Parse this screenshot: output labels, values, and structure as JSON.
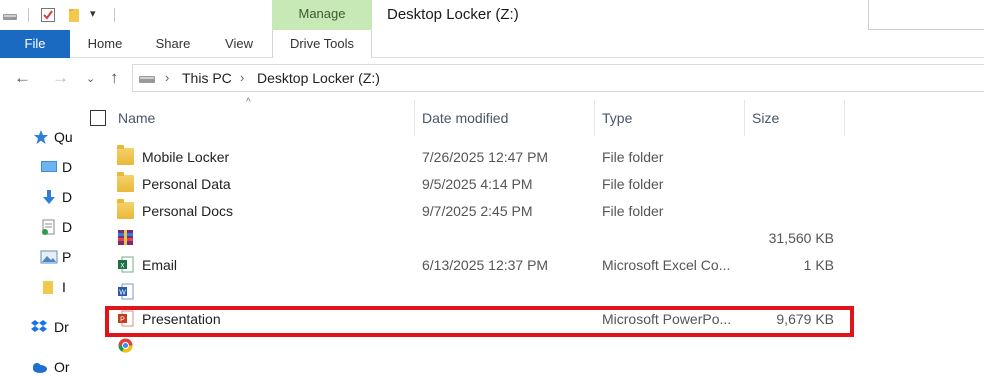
{
  "titlebar": {
    "manage_tab": "Manage",
    "window_title": "Desktop Locker (Z:)",
    "qa_dropdown": "▾"
  },
  "ribbon": {
    "file": "File",
    "home": "Home",
    "share": "Share",
    "view": "View",
    "drive_tools": "Drive Tools"
  },
  "address": {
    "crumbs": [
      "This PC",
      "Desktop Locker (Z:)"
    ]
  },
  "navpane": {
    "items": [
      {
        "label": "Qu",
        "icon": "star-icon"
      },
      {
        "label": "D",
        "icon": "desktop-icon"
      },
      {
        "label": "D",
        "icon": "downloads-icon"
      },
      {
        "label": "D",
        "icon": "documents-icon"
      },
      {
        "label": "P",
        "icon": "pictures-icon"
      },
      {
        "label": "I",
        "icon": "folder-icon"
      },
      {
        "label": "Dr",
        "icon": "dropbox-icon"
      },
      {
        "label": "Or",
        "icon": "onedrive-icon"
      }
    ]
  },
  "columns": {
    "name": "Name",
    "date": "Date modified",
    "type": "Type",
    "size": "Size"
  },
  "files": [
    {
      "name": "Mobile Locker",
      "date": "7/26/2025 12:47 PM",
      "type": "File folder",
      "size": "",
      "icon": "folder-icon"
    },
    {
      "name": "Personal Data",
      "date": "9/5/2025 4:14 PM",
      "type": "File folder",
      "size": "",
      "icon": "folder-icon"
    },
    {
      "name": "Personal Docs",
      "date": "9/7/2025 2:45 PM",
      "type": "File folder",
      "size": "",
      "icon": "folder-icon"
    },
    {
      "name": "",
      "date": "",
      "type": "",
      "size": "31,560 KB",
      "icon": "archive-icon"
    },
    {
      "name": "Email",
      "date": "6/13/2025 12:37 PM",
      "type": "Microsoft Excel Co...",
      "size": "1 KB",
      "icon": "excel-icon"
    },
    {
      "name": "",
      "date": "",
      "type": "",
      "size": "",
      "icon": "word-icon"
    },
    {
      "name": "Presentation",
      "date": "",
      "type": "Microsoft PowerPo...",
      "size": "9,679 KB",
      "icon": "powerpoint-icon"
    },
    {
      "name": "",
      "date": "",
      "type": "",
      "size": "",
      "icon": "chrome-icon"
    }
  ]
}
